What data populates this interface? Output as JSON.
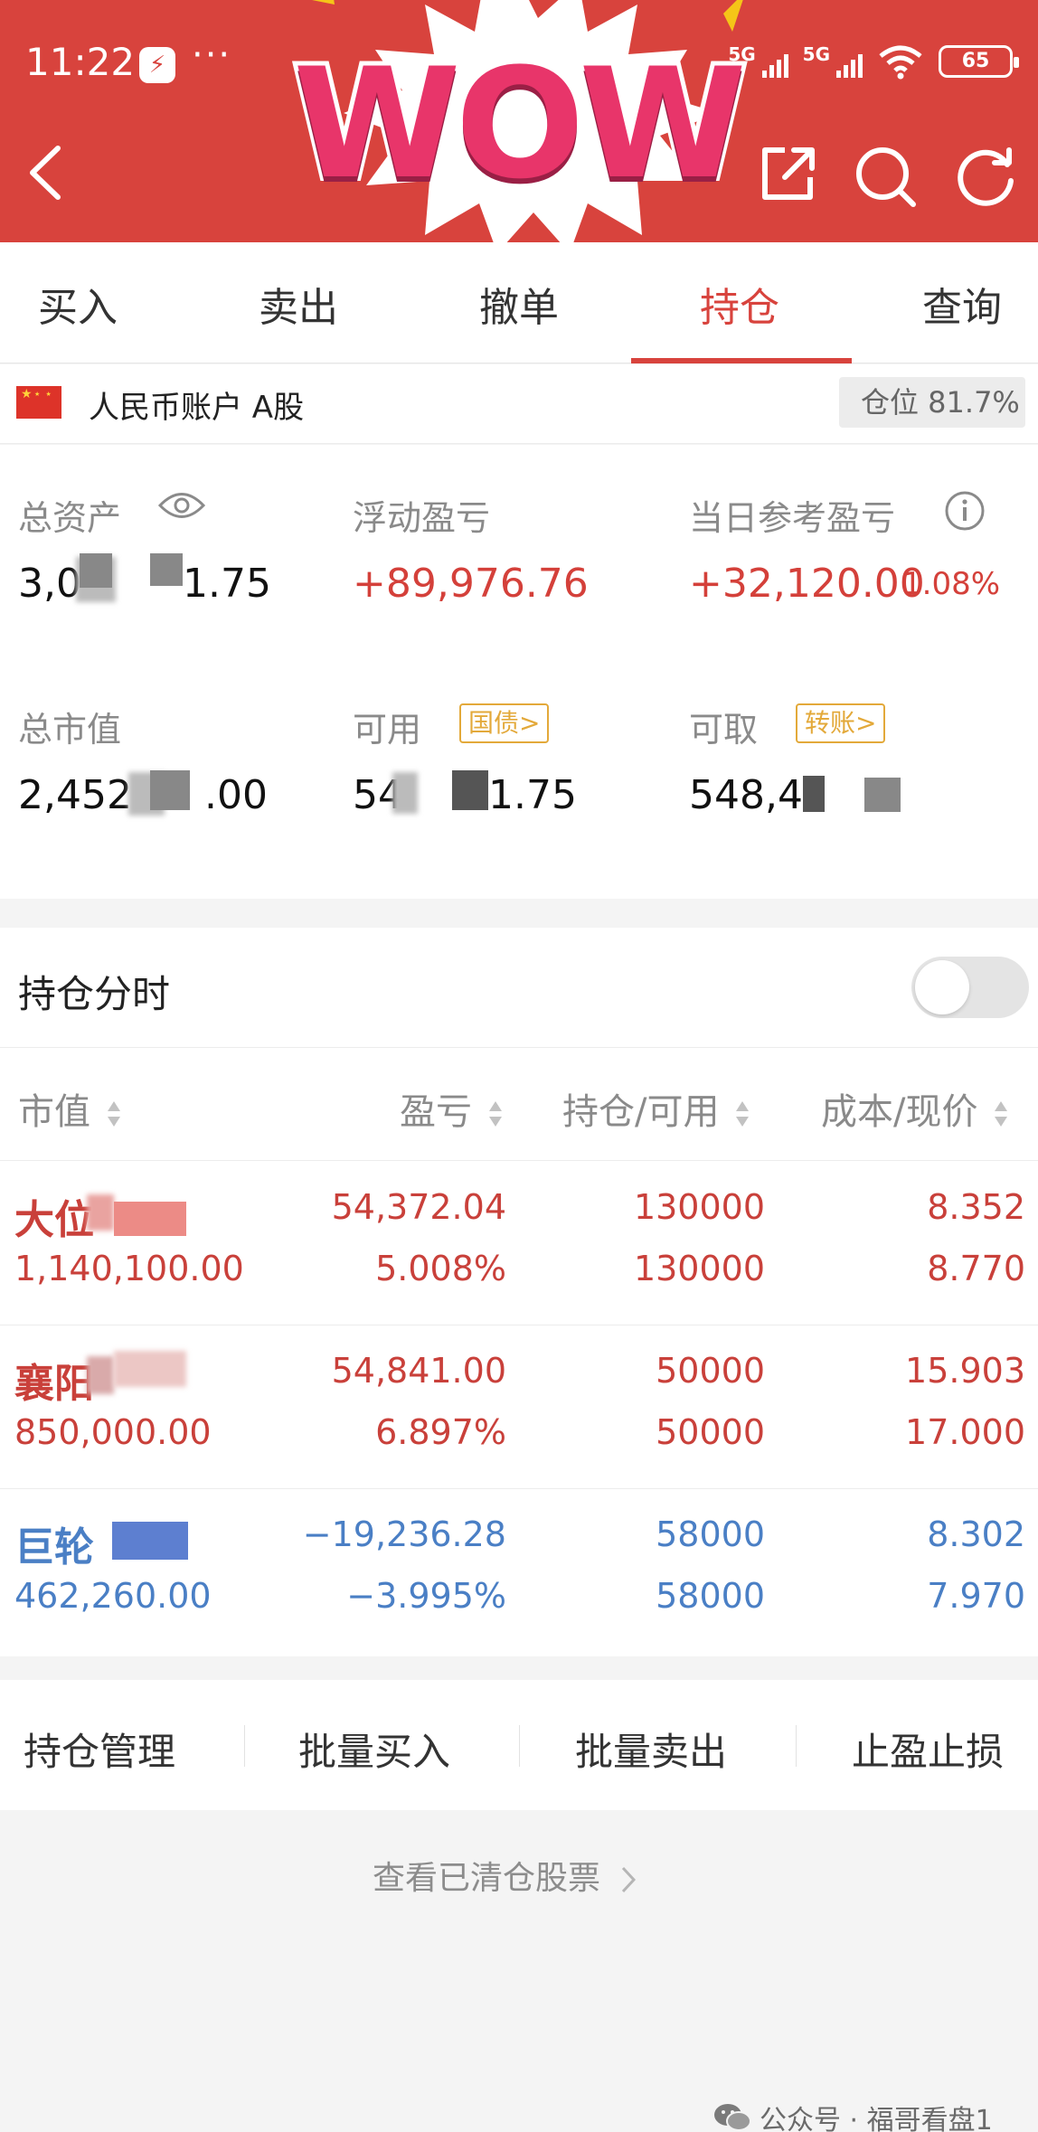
{
  "status_bar": {
    "time": "11:22",
    "more": "···",
    "signal_1": "5G",
    "signal_2": "5G",
    "battery": "65"
  },
  "header": {
    "sticker_text": "WOW",
    "icons": [
      "back-icon",
      "share-icon",
      "search-icon",
      "refresh-icon"
    ]
  },
  "tabs": [
    {
      "label": "买入"
    },
    {
      "label": "卖出"
    },
    {
      "label": "撤单"
    },
    {
      "label": "持仓"
    },
    {
      "label": "查询"
    }
  ],
  "active_tab": "持仓",
  "account": {
    "label": "人民币账户 A股",
    "position_ratio": "仓位 81.7%"
  },
  "summary": {
    "total_assets": {
      "label": "总资产",
      "value": "3,0",
      "value_tail": "1.75"
    },
    "floating_pl": {
      "label": "浮动盈亏",
      "value": "+89,976.76"
    },
    "daily_pl": {
      "label": "当日参考盈亏",
      "value": "+32,120.00",
      "pct": "1.08%"
    },
    "market_value": {
      "label": "总市值",
      "value": "2,452",
      "value_tail": ".00"
    },
    "available": {
      "label": "可用",
      "tag": "国债>",
      "value": "54",
      "value_tail": "1.75"
    },
    "withdrawable": {
      "label": "可取",
      "tag": "转账>",
      "value": "548,42"
    }
  },
  "holdings": {
    "title": "持仓分时",
    "toggle_on": false,
    "columns": [
      "市值",
      "盈亏",
      "持仓/可用",
      "成本/现价"
    ],
    "rows": [
      {
        "name": "大位",
        "market_value": "1,140,100.00",
        "pl": "54,372.04",
        "pl_pct": "5.008%",
        "position": "130000",
        "available": "130000",
        "cost": "8.352",
        "price": "8.770",
        "trend": "up"
      },
      {
        "name": "襄阳",
        "market_value": "850,000.00",
        "pl": "54,841.00",
        "pl_pct": "6.897%",
        "position": "50000",
        "available": "50000",
        "cost": "15.903",
        "price": "17.000",
        "trend": "up"
      },
      {
        "name": "巨轮",
        "market_value": "462,260.00",
        "pl": "−19,236.28",
        "pl_pct": "−3.995%",
        "position": "58000",
        "available": "58000",
        "cost": "8.302",
        "price": "7.970",
        "trend": "down"
      }
    ]
  },
  "actions": [
    "持仓管理",
    "批量买入",
    "批量卖出",
    "止盈止损"
  ],
  "cleared_link": "查看已清仓股票",
  "watermark": "公众号 · 福哥看盘1",
  "colors": {
    "brand": "#d8433d",
    "up": "#c9403a",
    "down": "#4a7fc5",
    "tag": "#e3a93a"
  }
}
